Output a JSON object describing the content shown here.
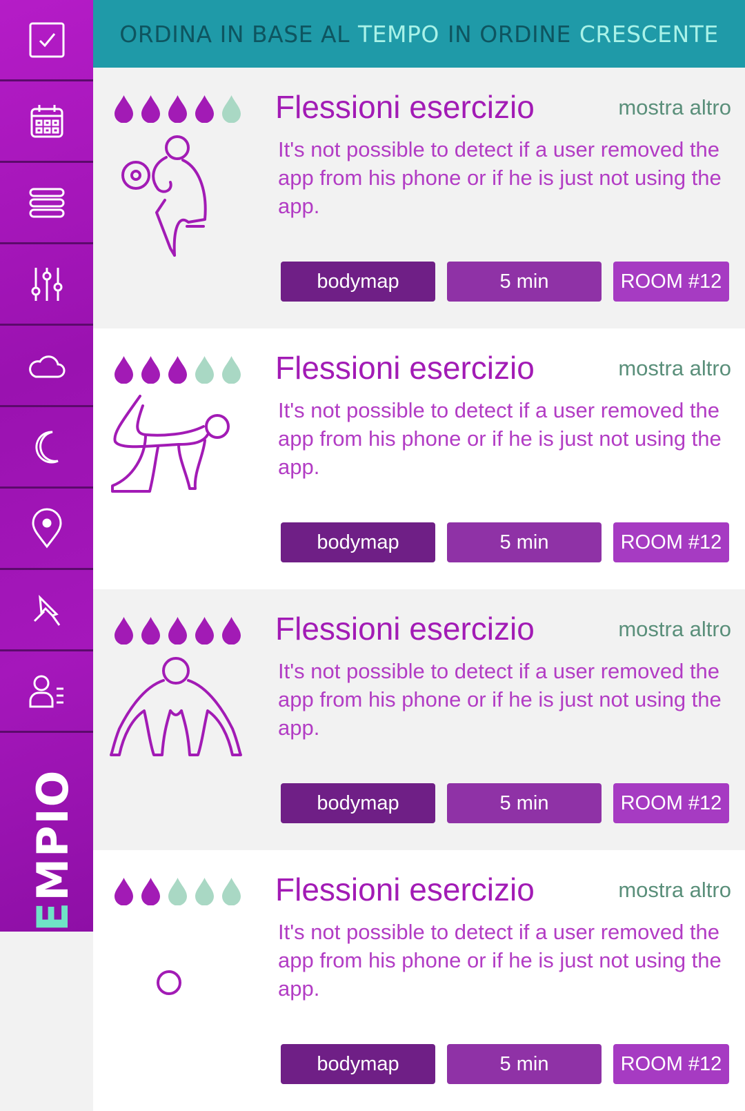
{
  "header": {
    "parts": [
      {
        "text": "ORDINA  IN BASE AL",
        "style": "dim"
      },
      {
        "text": "TEMPO",
        "style": "bright"
      },
      {
        "text": "IN ORDINE",
        "style": "dim"
      },
      {
        "text": "CRESCENTE",
        "style": "bright"
      }
    ]
  },
  "sidebar": {
    "items": [
      {
        "icon": "checkbox-icon"
      },
      {
        "icon": "calendar-icon"
      },
      {
        "icon": "stack-icon"
      },
      {
        "icon": "sliders-icon"
      },
      {
        "icon": "cloud-icon"
      },
      {
        "icon": "moon-icon"
      },
      {
        "icon": "location-pin-icon"
      },
      {
        "icon": "pushpin-icon"
      },
      {
        "icon": "user-list-icon"
      }
    ],
    "vertical_label": {
      "highlight": "E",
      "rest": "MPIO"
    }
  },
  "colors": {
    "sidebar": "#a517bb",
    "header": "#1f9aa8",
    "accent": "#a21bb5",
    "drop_filled": "#a21bb5",
    "drop_empty": "#a9d8c4"
  },
  "cards": [
    {
      "title": "Flessioni esercizio",
      "more": "mostra altro",
      "description": "It's not possible to detect if a user removed the app from his phone or if he is just not using the app.",
      "rating": 4,
      "rating_max": 5,
      "figure": "dumbbell-curl-figure-icon",
      "tags": [
        "bodymap",
        "5 min",
        "ROOM #12"
      ]
    },
    {
      "title": "Flessioni esercizio",
      "more": "mostra altro",
      "description": "It's not possible to detect if a user removed the app from his phone or if he is just not using the app.",
      "rating": 3,
      "rating_max": 5,
      "figure": "kneeling-leg-raise-figure-icon",
      "tags": [
        "bodymap",
        "5 min",
        "ROOM #12"
      ]
    },
    {
      "title": "Flessioni esercizio",
      "more": "mostra altro",
      "description": "It's not possible to detect if a user removed the app from his phone or if he is just not using the app.",
      "rating": 5,
      "rating_max": 5,
      "figure": "pushup-figure-icon",
      "tags": [
        "bodymap",
        "5 min",
        "ROOM #12"
      ]
    },
    {
      "title": "Flessioni esercizio",
      "more": "mostra altro",
      "description": "It's not possible to detect if a user removed the app from his phone or if he is just not using the app.",
      "rating": 2,
      "rating_max": 5,
      "figure": "person-figure-icon",
      "tags": [
        "bodymap",
        "5 min",
        "ROOM #12"
      ]
    }
  ]
}
